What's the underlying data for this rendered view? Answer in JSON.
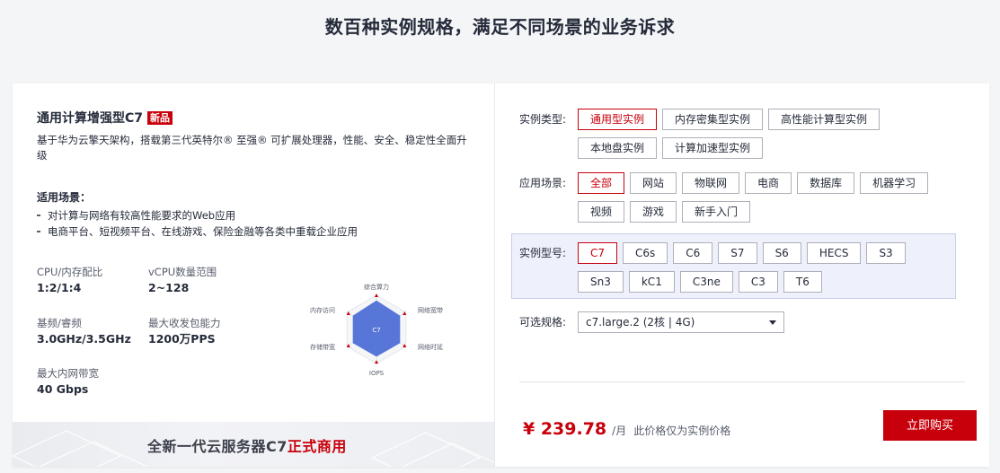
{
  "heading": "数百种实例规格，满足不同场景的业务诉求",
  "product": {
    "title": "通用计算增强型C7",
    "badge": "新品",
    "description": "基于华为云擎天架构，搭载第三代英特尔® 至强® 可扩展处理器，性能、安全、稳定性全面升级",
    "scenes_title": "适用场景：",
    "scenes": [
      "对计算与网络有较高性能要求的Web应用",
      "电商平台、短视频平台、在线游戏、保险金融等各类中重载企业应用"
    ],
    "specs": [
      {
        "key": "CPU/内存配比",
        "value": "1:2/1:4"
      },
      {
        "key": "vCPU数量范围",
        "value": "2~128"
      },
      {
        "key": "基频/睿频",
        "value": "3.0GHz/3.5GHz"
      },
      {
        "key": "最大收发包能力",
        "value": "1200万PPS"
      },
      {
        "key": "最大内网带宽",
        "value": "40 Gbps"
      }
    ],
    "radar": {
      "center_label": "C7",
      "axes": [
        "综合算力",
        "网络宽带",
        "网络时延",
        "IOPS",
        "存储带宽",
        "内存访问"
      ],
      "values": [
        0.85,
        0.8,
        0.8,
        0.8,
        0.8,
        0.8
      ]
    }
  },
  "banner": {
    "prefix": "全新一代云服务器C7",
    "highlight": "正式商用"
  },
  "filters": {
    "instance_type": {
      "label": "实例类型:",
      "options": [
        "通用型实例",
        "内存密集型实例",
        "高性能计算型实例",
        "本地盘实例",
        "计算加速型实例"
      ],
      "active": 0
    },
    "scenario": {
      "label": "应用场景:",
      "options": [
        "全部",
        "网站",
        "物联网",
        "电商",
        "数据库",
        "机器学习",
        "视频",
        "游戏",
        "新手入门"
      ],
      "active": 0
    },
    "model": {
      "label": "实例型号:",
      "options": [
        "C7",
        "C6s",
        "C6",
        "S7",
        "S6",
        "HECS",
        "S3",
        "Sn3",
        "kC1",
        "C3ne",
        "C3",
        "T6"
      ],
      "active": 0
    },
    "spec": {
      "label": "可选规格:",
      "value": "c7.large.2 (2核 | 4G)"
    }
  },
  "price": {
    "amount": "¥ 239.78",
    "unit": "/月",
    "note": "此价格仅为实例价格"
  },
  "buy_label": "立即购买",
  "colors": {
    "accent": "#c7000b",
    "radar_fill": "#4e6fd6"
  }
}
